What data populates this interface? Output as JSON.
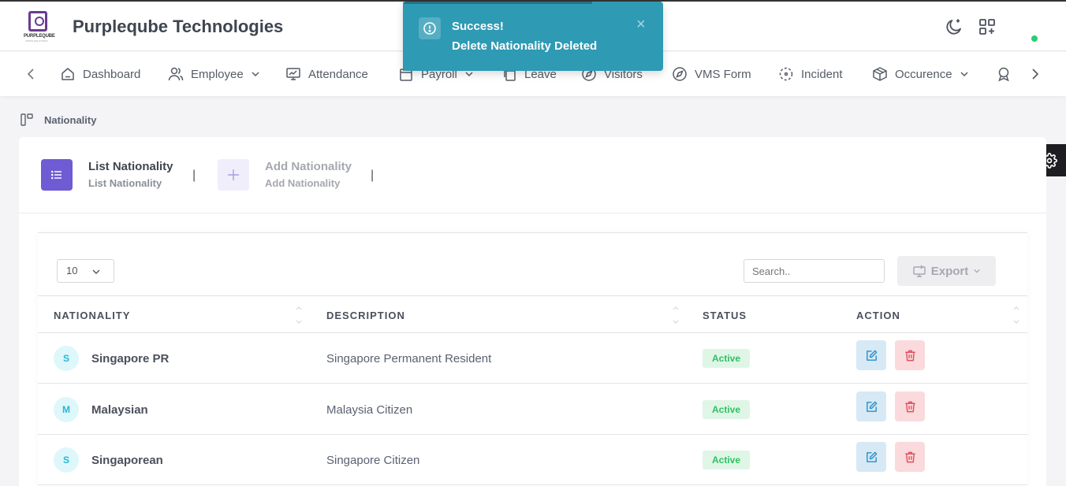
{
  "app": {
    "company_name": "Purpleqube Technologies",
    "logo_text": "PURPLEQUBE",
    "logo_sub": "VISION SOLUTIONS"
  },
  "header": {
    "icons": [
      "moon-icon",
      "apps-add-icon"
    ],
    "online_color": "#2ecc71"
  },
  "nav": {
    "items": [
      {
        "label": "Dashboard",
        "icon": "home-icon",
        "dropdown": false
      },
      {
        "label": "Employee",
        "icon": "users-icon",
        "dropdown": true
      },
      {
        "label": "Attendance",
        "icon": "monitor-icon",
        "dropdown": false
      },
      {
        "label": "Payroll",
        "icon": "calendar-icon",
        "dropdown": true
      },
      {
        "label": "Leave",
        "icon": "copy-icon",
        "dropdown": false
      },
      {
        "label": "Visitors",
        "icon": "compass-icon",
        "dropdown": false
      },
      {
        "label": "VMS Form",
        "icon": "compass-icon",
        "dropdown": false
      },
      {
        "label": "Incident",
        "icon": "focus-icon",
        "dropdown": false
      },
      {
        "label": "Occurence",
        "icon": "box-icon",
        "dropdown": true
      }
    ]
  },
  "toast": {
    "title": "Success!",
    "message": "Delete Nationality Deleted",
    "color": "#2e9ab4"
  },
  "breadcrumb": {
    "label": "Nationality"
  },
  "tabs": [
    {
      "title": "List Nationality",
      "subtitle": "List Nationality",
      "active": true
    },
    {
      "title": "Add Nationality",
      "subtitle": "Add Nationality",
      "active": false
    }
  ],
  "table_controls": {
    "page_size": "10",
    "search_placeholder": "Search..",
    "export_label": "Export"
  },
  "table": {
    "columns": [
      "NATIONALITY",
      "DESCRIPTION",
      "STATUS",
      "ACTION"
    ],
    "rows": [
      {
        "initial": "S",
        "nationality": "Singapore PR",
        "description": "Singapore Permanent Resident",
        "status": "Active"
      },
      {
        "initial": "M",
        "nationality": "Malaysian",
        "description": "Malaysia Citizen",
        "status": "Active"
      },
      {
        "initial": "S",
        "nationality": "Singaporean",
        "description": "Singapore Citizen",
        "status": "Active"
      }
    ]
  },
  "colors": {
    "accent": "#6f5bd3",
    "active_badge": "#2fbf62",
    "edit": "#2a8fc7",
    "delete": "#e0505b"
  }
}
